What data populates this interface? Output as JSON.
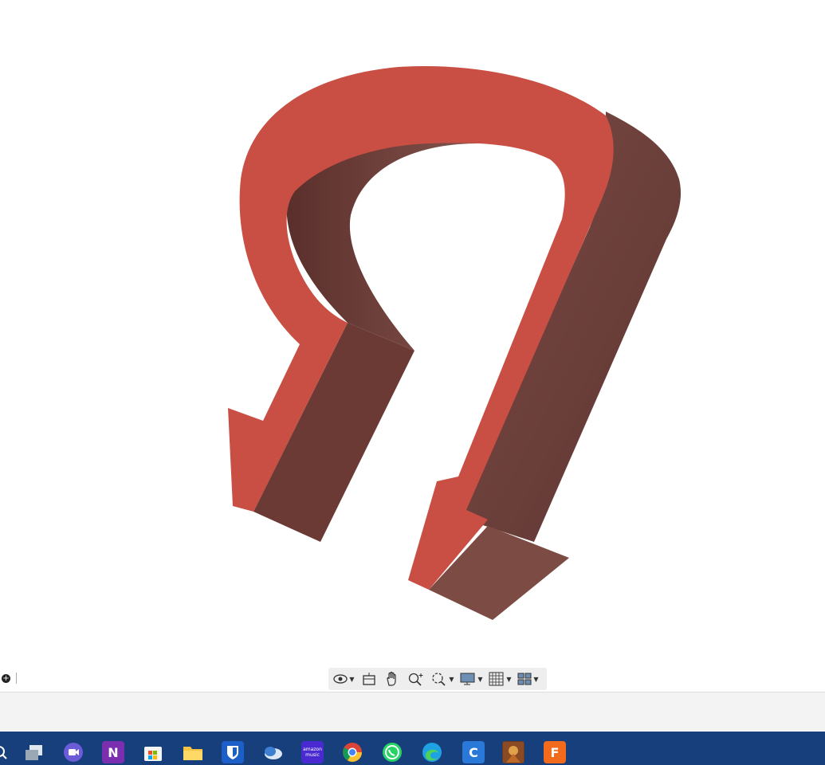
{
  "model": {
    "name": "arrow-loop-shape",
    "face_color": "#c94f44",
    "side_color": "#6b3a35"
  },
  "navigation_toolbar": {
    "tools": [
      "orbit",
      "look-at",
      "pan",
      "zoom",
      "fit",
      "display-settings",
      "grid",
      "viewports"
    ]
  },
  "taskbar": {
    "background": "#173f7c",
    "apps": [
      {
        "name": "task-view",
        "glyph": ""
      },
      {
        "name": "teams-video",
        "glyph": ""
      },
      {
        "name": "onenote",
        "glyph": "N"
      },
      {
        "name": "microsoft-store",
        "glyph": ""
      },
      {
        "name": "file-explorer",
        "glyph": ""
      },
      {
        "name": "bitwarden",
        "glyph": ""
      },
      {
        "name": "cloud-app",
        "glyph": ""
      },
      {
        "name": "amazon-music",
        "glyph": "amazon music"
      },
      {
        "name": "chrome",
        "glyph": ""
      },
      {
        "name": "whatsapp",
        "glyph": ""
      },
      {
        "name": "edge",
        "glyph": ""
      },
      {
        "name": "ccleaner",
        "glyph": "C"
      },
      {
        "name": "game",
        "glyph": ""
      },
      {
        "name": "fusion-360",
        "glyph": "F"
      }
    ]
  }
}
